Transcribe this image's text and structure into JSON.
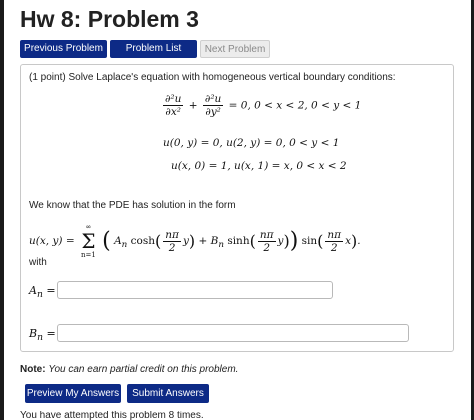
{
  "title": "Hw 8: Problem 3",
  "nav": {
    "previous": "Previous Problem",
    "list": "Problem List",
    "next": "Next Problem"
  },
  "problem": {
    "statement": "(1 point) Solve Laplace's equation with homogeneous vertical boundary conditions:",
    "eq1": {
      "num1": "∂²u",
      "den1": "∂x²",
      "plus": "+",
      "num2": "∂²u",
      "den2": "∂y²",
      "rest": "= 0, 0 < x < 2, 0 < y < 1"
    },
    "eq2": "u(0, y) = 0,     u(2, y) = 0, 0 < y < 1",
    "eq3": "u(x, 0) = 1,     u(x, 1) = x, 0 < x < 2",
    "know_text": "We know that the PDE has solution in the form",
    "series": {
      "lhs": "u(x, y) =",
      "sigma_top": "∞",
      "sigma_bottom": "n=1",
      "term_a": "A",
      "term_a_sub": "n",
      "cosh": "cosh",
      "frac_num": "nπ",
      "frac_den": "2",
      "var_y": "y",
      "plus_b": "+ B",
      "term_b_sub": "n",
      "sinh": "sinh",
      "sin": "sin",
      "var_x": "x",
      "end": "."
    },
    "with_text": "with",
    "a_label": "A",
    "a_sub": "n",
    "a_eq": " =",
    "b_label": "B",
    "b_sub": "n",
    "b_eq": " =",
    "a_value": "",
    "b_value": ""
  },
  "note": {
    "label": "Note:",
    "text": "You can earn partial credit on this problem."
  },
  "buttons": {
    "preview": "Preview My Answers",
    "submit": "Submit Answers"
  },
  "attempted_text": "You have attempted this problem 8 times."
}
